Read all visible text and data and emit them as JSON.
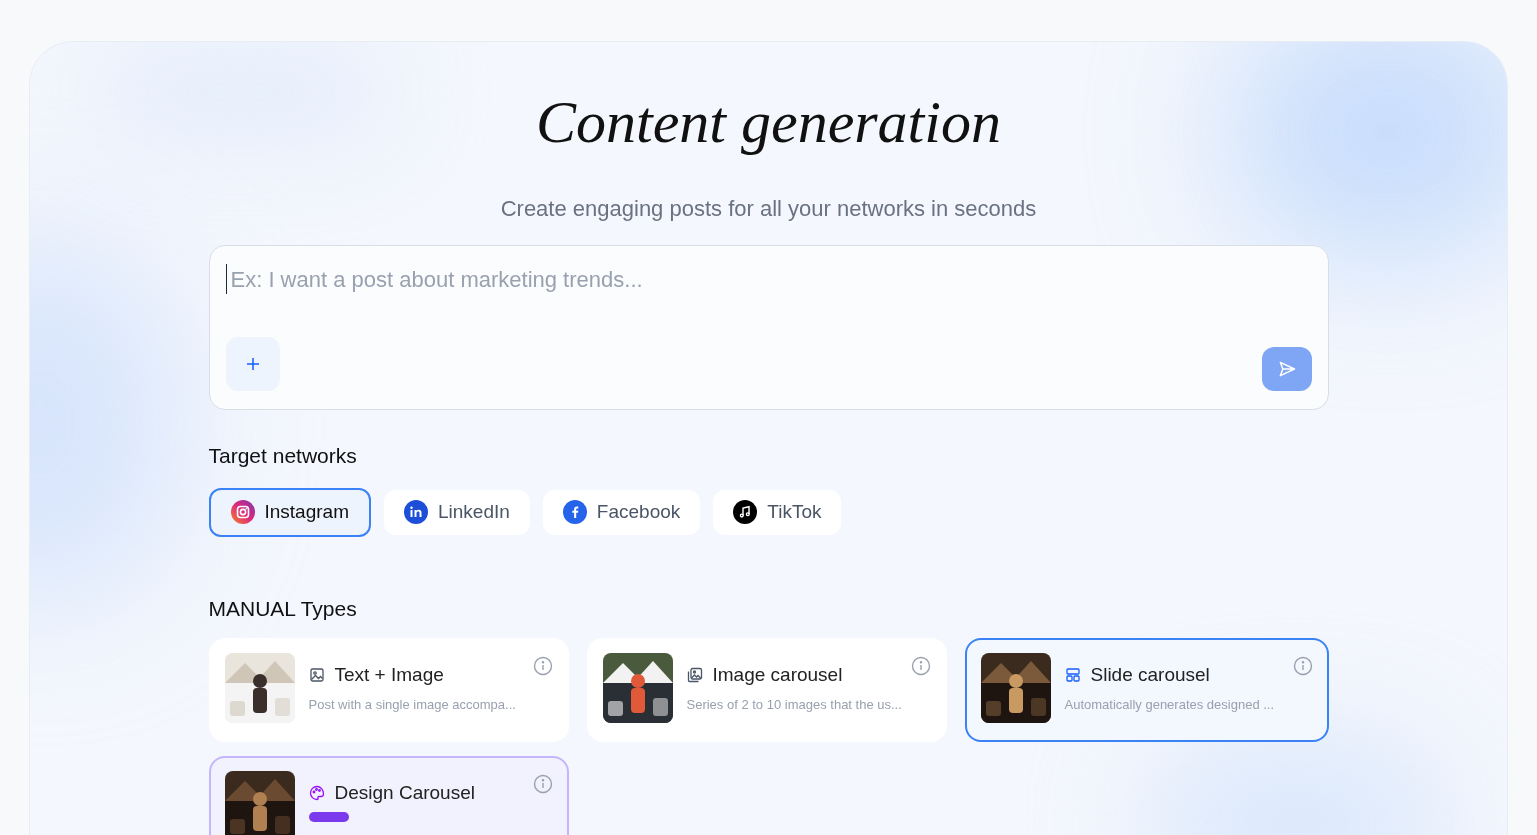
{
  "header": {
    "title": "Content generation",
    "subtitle": "Create engaging posts for all your networks in seconds"
  },
  "prompt": {
    "placeholder": "Ex: I want a post about marketing trends..."
  },
  "networks": {
    "title": "Target networks",
    "items": [
      {
        "label": "Instagram",
        "kind": "instagram",
        "selected": true
      },
      {
        "label": "LinkedIn",
        "kind": "linkedin",
        "selected": false
      },
      {
        "label": "Facebook",
        "kind": "facebook",
        "selected": false
      },
      {
        "label": "TikTok",
        "kind": "tiktok",
        "selected": false
      }
    ]
  },
  "types": {
    "title": "MANUAL Types",
    "items": [
      {
        "name": "Text + Image",
        "description": "Post with a single image accompa...",
        "kind": "text-image",
        "selected": false,
        "highlighted": false
      },
      {
        "name": "Image carousel",
        "description": "Series of 2 to 10 images that the us...",
        "kind": "image-carousel",
        "selected": false,
        "highlighted": false
      },
      {
        "name": "Slide carousel",
        "description": "Automatically generates designed ...",
        "kind": "slide-carousel",
        "selected": true,
        "highlighted": false
      },
      {
        "name": "Design Carousel",
        "kind": "design-carousel",
        "selected": false,
        "highlighted": true,
        "tag": true
      }
    ]
  }
}
